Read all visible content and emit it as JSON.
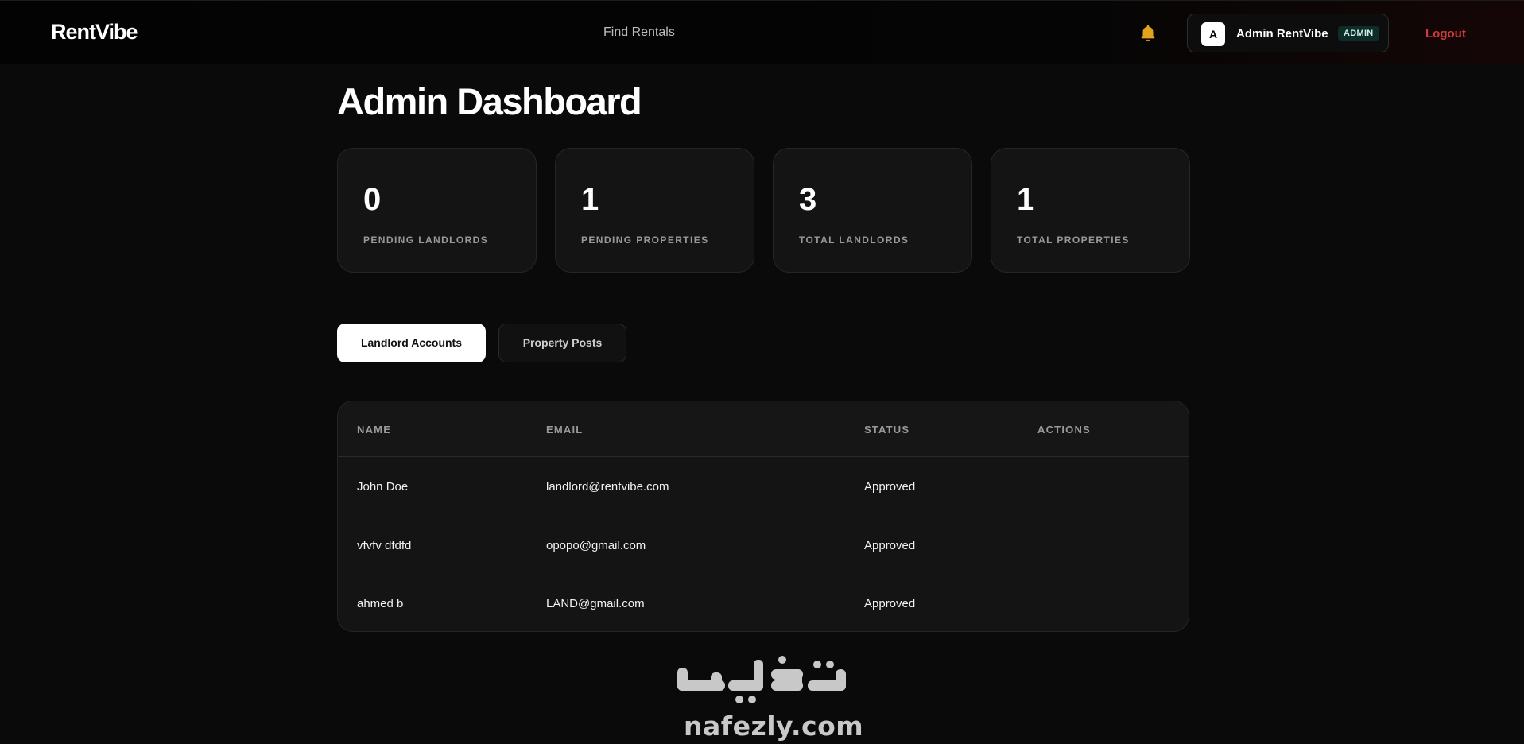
{
  "navbar": {
    "logo": "RentVibe",
    "links": [
      {
        "label": "Find Rentals"
      }
    ],
    "notifications_icon": "bell-icon",
    "user": {
      "initial": "A",
      "name": "Admin RentVibe",
      "role": "ADMIN"
    },
    "logout_label": "Logout"
  },
  "page": {
    "title": "Admin Dashboard"
  },
  "stats": [
    {
      "value": "0",
      "label": "PENDING LANDLORDS"
    },
    {
      "value": "1",
      "label": "PENDING PROPERTIES"
    },
    {
      "value": "3",
      "label": "TOTAL LANDLORDS"
    },
    {
      "value": "1",
      "label": "TOTAL PROPERTIES"
    }
  ],
  "tabs": [
    {
      "label": "Landlord Accounts",
      "active": true
    },
    {
      "label": "Property Posts",
      "active": false
    }
  ],
  "table": {
    "columns": [
      "NAME",
      "EMAIL",
      "STATUS",
      "ACTIONS"
    ],
    "rows": [
      {
        "name": "John Doe",
        "email": "landlord@rentvibe.com",
        "status": "Approved"
      },
      {
        "name": "vfvfv dfdfd",
        "email": "opopo@gmail.com",
        "status": "Approved"
      },
      {
        "name": "ahmed b",
        "email": "LAND@gmail.com",
        "status": "Approved"
      }
    ]
  },
  "watermark": {
    "arabic": "نفذلي",
    "latin": "nafezly.com"
  },
  "colors": {
    "background": "#0a0a0a",
    "card": "#141414",
    "accent_logout": "#d03a3a",
    "bell": "#e0a31f",
    "badge_bg": "#0f2d28"
  }
}
